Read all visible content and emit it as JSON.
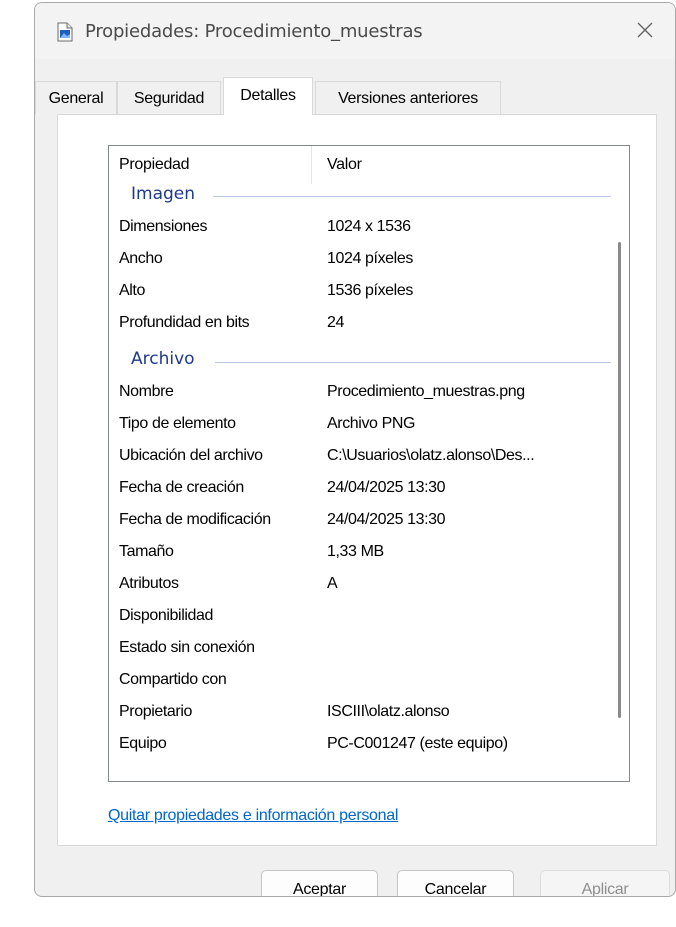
{
  "window": {
    "title": "Propiedades: Procedimiento_muestras"
  },
  "tabs": [
    {
      "label": "General"
    },
    {
      "label": "Seguridad"
    },
    {
      "label": "Detalles"
    },
    {
      "label": "Versiones anteriores"
    }
  ],
  "details": {
    "headers": {
      "property": "Propiedad",
      "value": "Valor"
    },
    "groups": [
      {
        "label": "Imagen",
        "rows": [
          {
            "name": "Dimensiones",
            "value": "1024 x 1536"
          },
          {
            "name": "Ancho",
            "value": "1024 píxeles"
          },
          {
            "name": "Alto",
            "value": "1536 píxeles"
          },
          {
            "name": "Profundidad en bits",
            "value": "24"
          }
        ]
      },
      {
        "label": "Archivo",
        "rows": [
          {
            "name": "Nombre",
            "value": "Procedimiento_muestras.png"
          },
          {
            "name": "Tipo de elemento",
            "value": "Archivo PNG"
          },
          {
            "name": "Ubicación del archivo",
            "value": "C:\\Usuarios\\olatz.alonso\\Des..."
          },
          {
            "name": "Fecha de creación",
            "value": "24/04/2025 13:30"
          },
          {
            "name": "Fecha de modificación",
            "value": "24/04/2025 13:30"
          },
          {
            "name": "Tamaño",
            "value": "1,33 MB"
          },
          {
            "name": "Atributos",
            "value": "A"
          },
          {
            "name": "Disponibilidad",
            "value": ""
          },
          {
            "name": "Estado sin conexión",
            "value": ""
          },
          {
            "name": "Compartido con",
            "value": ""
          },
          {
            "name": "Propietario",
            "value": "ISCIII\\olatz.alonso"
          },
          {
            "name": "Equipo",
            "value": "PC-C001247 (este equipo)"
          }
        ]
      }
    ]
  },
  "link": {
    "label": "Quitar propiedades e información personal"
  },
  "buttons": {
    "ok": "Aceptar",
    "cancel": "Cancelar",
    "apply": "Aplicar"
  },
  "colors": {
    "accent_link": "#0066cc",
    "group_header": "#1e3a8a"
  }
}
